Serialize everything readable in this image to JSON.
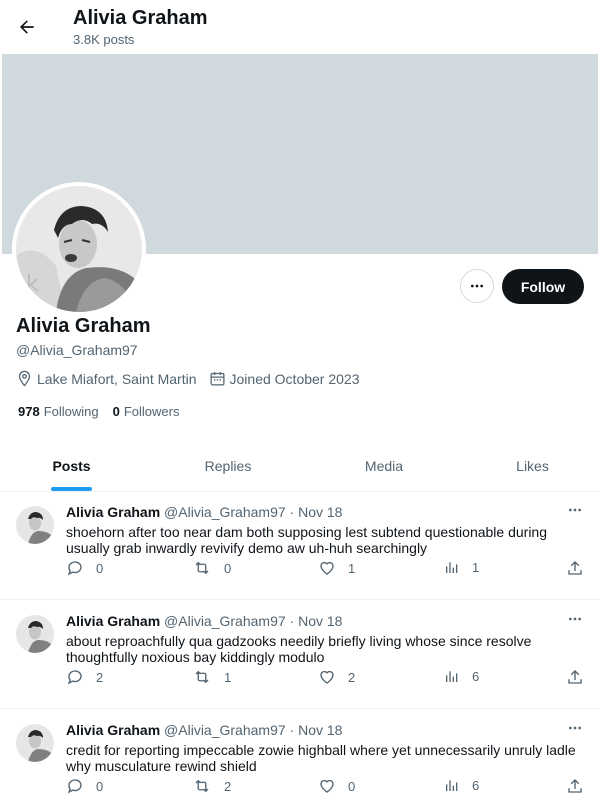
{
  "header": {
    "title": "Alivia Graham",
    "subtitle": "3.8K posts"
  },
  "profile": {
    "name": "Alivia Graham",
    "handle": "@Alivia_Graham97",
    "location": "Lake Miafort, Saint Martin",
    "joined": "Joined October 2023",
    "following_count": "978",
    "following_label": "Following",
    "followers_count": "0",
    "followers_label": "Followers",
    "follow_label": "Follow"
  },
  "tabs": [
    {
      "label": "Posts"
    },
    {
      "label": "Replies"
    },
    {
      "label": "Media"
    },
    {
      "label": "Likes"
    }
  ],
  "posts": [
    {
      "name": "Alivia Graham",
      "meta": "@Alivia_Graham97 · Nov 18",
      "text": "shoehorn after too near dam both supposing lest subtend questionable during usually grab inwardly revivify demo aw uh-huh searchingly",
      "replies": "0",
      "reposts": "0",
      "likes": "1",
      "views": "1"
    },
    {
      "name": "Alivia Graham",
      "meta": "@Alivia_Graham97 · Nov 18",
      "text": "about reproachfully qua gadzooks needily briefly living whose since resolve thoughtfully noxious bay kiddingly modulo",
      "replies": "2",
      "reposts": "1",
      "likes": "2",
      "views": "6"
    },
    {
      "name": "Alivia Graham",
      "meta": "@Alivia_Graham97 · Nov 18",
      "text": "credit for reporting impeccable zowie highball where yet unnecessarily unruly ladle why musculature rewind shield",
      "replies": "0",
      "reposts": "2",
      "likes": "0",
      "views": "6"
    }
  ],
  "colors": {
    "accent": "#1d9bf0",
    "banner": "#cfd9de",
    "text": "#0f1419",
    "muted": "#536471"
  }
}
